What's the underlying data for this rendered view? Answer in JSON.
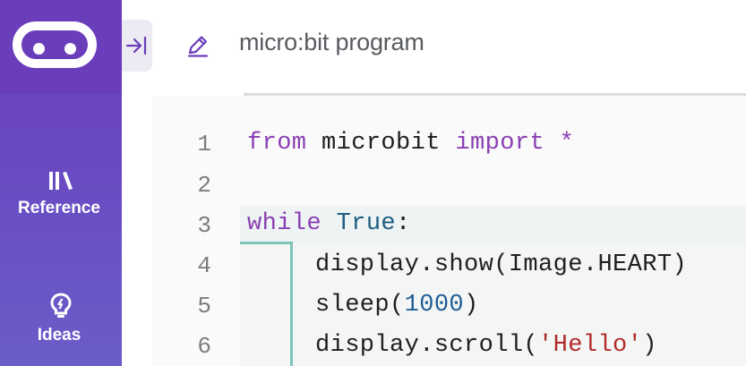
{
  "sidebar": {
    "logo_icon": "microbit-logo-icon",
    "items": [
      {
        "label": "Reference",
        "icon": "books-icon"
      },
      {
        "label": "Ideas",
        "icon": "lightbulb-icon"
      }
    ],
    "collapse_icon": "collapse-arrow-icon"
  },
  "header": {
    "edit_icon": "pencil-icon",
    "project_name": "micro:bit program"
  },
  "editor": {
    "line_numbers": [
      "1",
      "2",
      "3",
      "4",
      "5",
      "6"
    ],
    "lines": {
      "l1_from": "from",
      "l1_mod": " microbit ",
      "l1_import": "import",
      "l1_star": " *",
      "l3_while": "while",
      "l3_true": "True",
      "l3_colon": ":",
      "l4": "display.show(Image.HEART)",
      "l5_fn": "sleep(",
      "l5_num": "1000",
      "l5_close": ")",
      "l6_fn": "display.scroll(",
      "l6_str": "'Hello'",
      "l6_close": ")"
    }
  },
  "colors": {
    "sidebar": "#6a3dbb",
    "keyword": "#8a3fb3",
    "builtin": "#1e5d80",
    "string": "#b32a2a",
    "indent_guide": "#7cc4b8"
  }
}
